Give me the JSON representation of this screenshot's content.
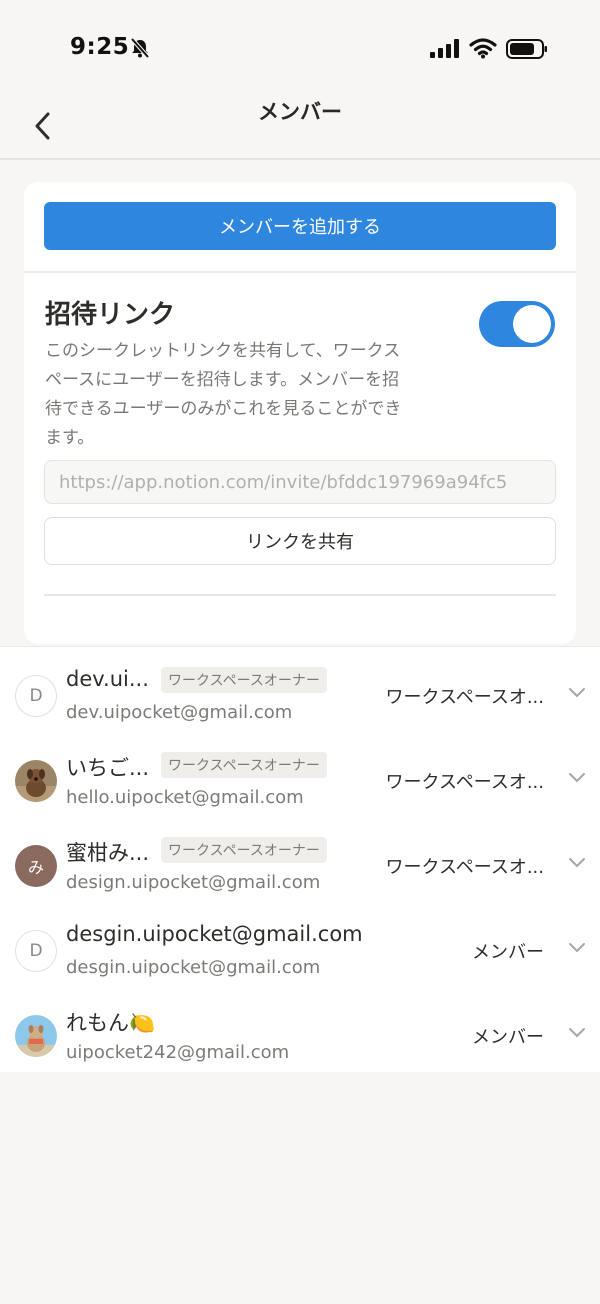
{
  "status_bar": {
    "time": "9:25"
  },
  "nav": {
    "title": "メンバー"
  },
  "card": {
    "add_member_label": "メンバーを追加する",
    "invite_title": "招待リンク",
    "invite_description": "このシークレットリンクを共有して、ワークスペースにユーザーを招待します。メンバーを招待できるユーザーのみがこれを見ることができます。",
    "invite_toggle_on": true,
    "invite_link": "https://app.notion.com/invite/bfddc197969a94fc5",
    "share_link_label": "リンクを共有"
  },
  "members": [
    {
      "name": "dev.ui...",
      "badge": "ワークスペースオーナー",
      "email": "dev.uipocket@gmail.com",
      "role": "ワークスペースオ...",
      "avatar": "D"
    },
    {
      "name": "いちご...",
      "badge": "ワークスペースオーナー",
      "email": "hello.uipocket@gmail.com",
      "role": "ワークスペースオ...",
      "avatar": "dog-photo"
    },
    {
      "name": "蜜柑み...",
      "badge": "ワークスペースオーナー",
      "email": "design.uipocket@gmail.com",
      "role": "ワークスペースオ...",
      "avatar": "み"
    },
    {
      "name": "desgin.uipocket@gmail.com",
      "badge": "",
      "email": "desgin.uipocket@gmail.com",
      "role": "メンバー",
      "avatar": "D"
    },
    {
      "name": "れもん🍋",
      "badge": "",
      "email": "uipocket242@gmail.com",
      "role": "メンバー",
      "avatar": "dog-photo-blue"
    }
  ],
  "colors": {
    "accent": "#2e86de",
    "background": "#f7f6f4"
  }
}
